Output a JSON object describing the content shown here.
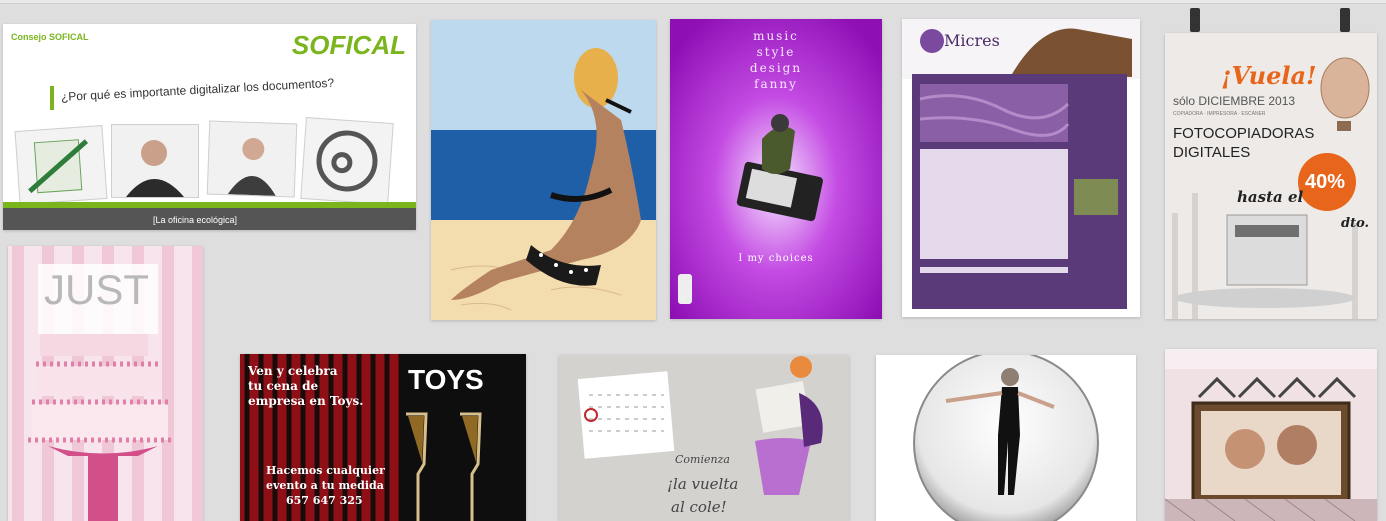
{
  "gallery": {
    "sofical": {
      "header": "Consejo SOFICAL",
      "brand": "SOFICAL",
      "question": "¿Por qué es importante digitalizar los documentos?",
      "footer": "[La oficina ecológica]"
    },
    "beach": {},
    "music": {
      "lines": [
        "music",
        "style",
        "design",
        "fanny"
      ],
      "tagline": "I my choices"
    },
    "micres": {
      "brand": "Micres"
    },
    "vuela": {
      "headline": "¡Vuela!",
      "sub": "sólo DICIEMBRE 2013",
      "tiny": "COPIADORA · IMPRESORA · ESCÁNER",
      "title1": "FOTOCOPIADORAS",
      "title2": "DIGITALES",
      "discount_lead": "hasta el",
      "discount": "40%",
      "dto": "dto."
    },
    "just": {
      "word": "JUST"
    },
    "toys": {
      "promo1": "Ven y celebra",
      "promo2": "tu cena de",
      "promo3": "empresa en Toys.",
      "brand": "TOYS",
      "footer1": "Hacemos cualquier",
      "footer2": "evento a tu medida",
      "phone": "657 647 325"
    },
    "vuelta": {
      "line1": "Comienza",
      "line2": "¡la vuelta",
      "line3": "al cole!"
    },
    "dancer": {},
    "room": {}
  },
  "colors": {
    "page_bg": "#dedede",
    "sofical_green": "#7ab51d",
    "music_purple": "#b31ad1",
    "micres_purple": "#5b3a7a",
    "vuela_orange": "#e8661b",
    "toys_red": "#b3121a",
    "just_pink": "#e8a6c2"
  }
}
